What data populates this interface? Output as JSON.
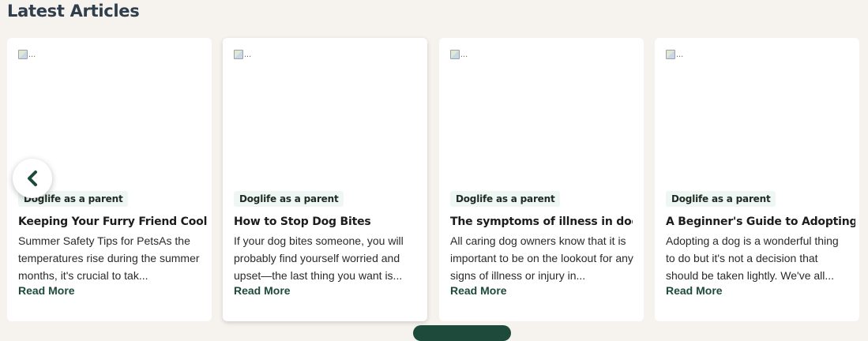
{
  "section": {
    "title": "Latest Articles"
  },
  "image_alt": "...",
  "articles": [
    {
      "tag": "Doglife as a parent",
      "title": "Keeping Your Furry Friend Cool:",
      "excerpt": "Summer Safety Tips for PetsAs the temperatures rise during the summer months, it's crucial to tak...",
      "read_more": "Read More"
    },
    {
      "tag": "Doglife as a parent",
      "title": "How to Stop Dog Bites",
      "excerpt": "If your dog bites someone, you will probably find yourself worried and upset—the last thing you want is...",
      "read_more": "Read More"
    },
    {
      "tag": "Doglife as a parent",
      "title": "The symptoms of illness in dogs",
      "excerpt": "All caring dog owners know that it is important to be on the lookout for any signs of illness or injury in...",
      "read_more": "Read More"
    },
    {
      "tag": "Doglife as a parent",
      "title": "A Beginner's Guide to Adopting",
      "excerpt": "Adopting a dog is a wonderful thing to do but it's not a decision that should be taken lightly. We've all...",
      "read_more": "Read More"
    }
  ],
  "carousel": {
    "prev_icon": "chevron-left-icon"
  },
  "colors": {
    "accent": "#1d4a3a",
    "background": "#f6f2ee",
    "tag_bg": "#eef7f3"
  }
}
